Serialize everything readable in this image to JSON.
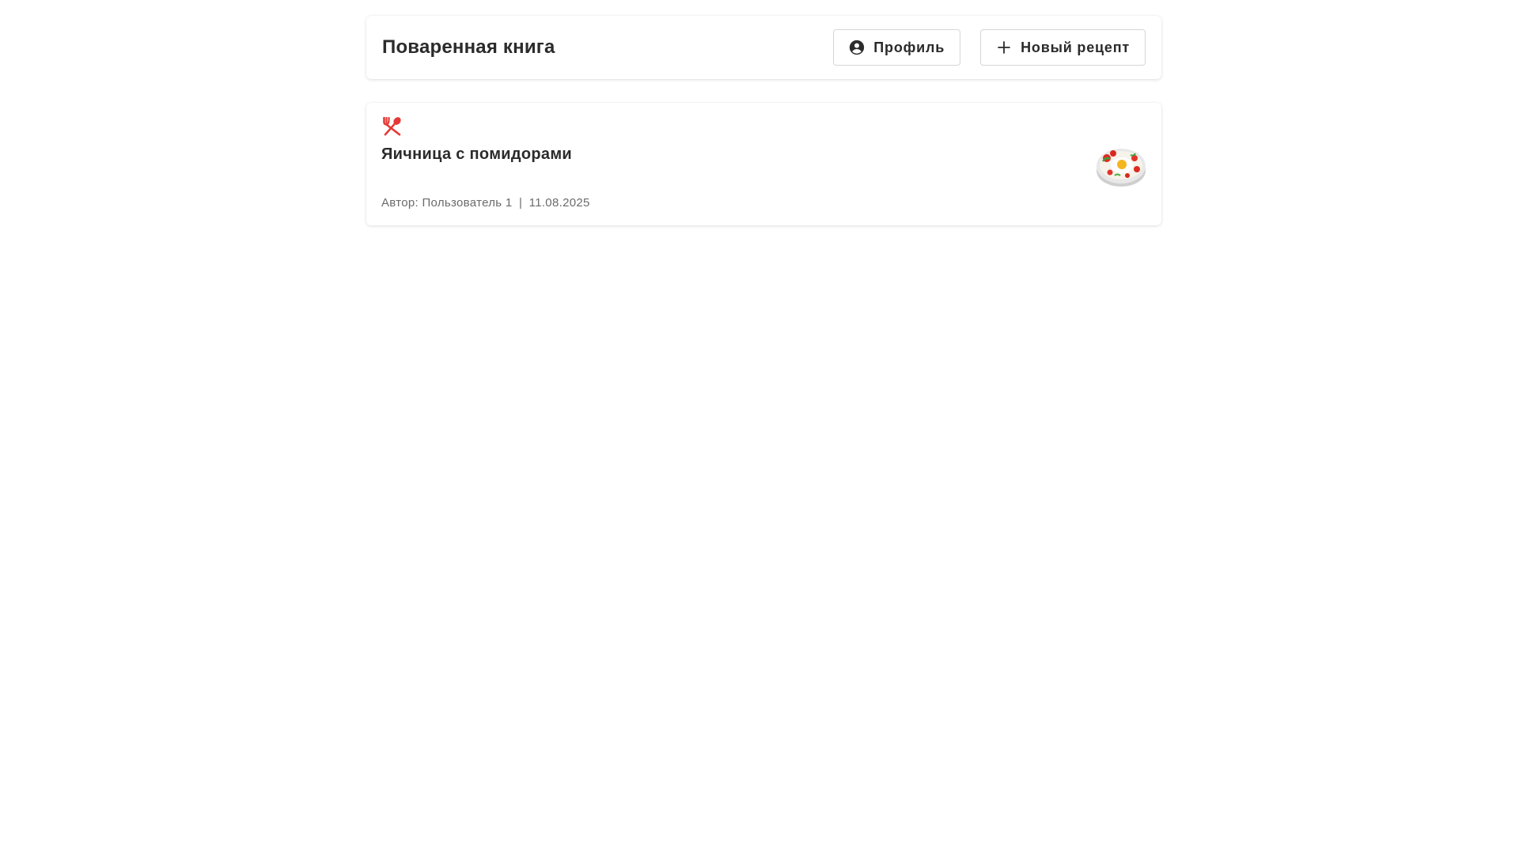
{
  "header": {
    "title": "Поваренная книга",
    "profile_label": "Профиль",
    "profile_icon": "account-circle-icon",
    "new_recipe_label": "Новый рецепт",
    "new_recipe_icon": "plus-icon"
  },
  "recipes": [
    {
      "icon": "fork-spoon-icon",
      "title": "Яичница с помидорами",
      "author_prefix": "Автор:",
      "author": "Пользователь 1",
      "separator": "|",
      "date": "11.08.2025",
      "thumbnail": "fried-eggs-with-tomatoes-image"
    }
  ],
  "colors": {
    "accent": "#e53935",
    "text": "#2b2b2b",
    "muted": "#6b6b6b"
  }
}
